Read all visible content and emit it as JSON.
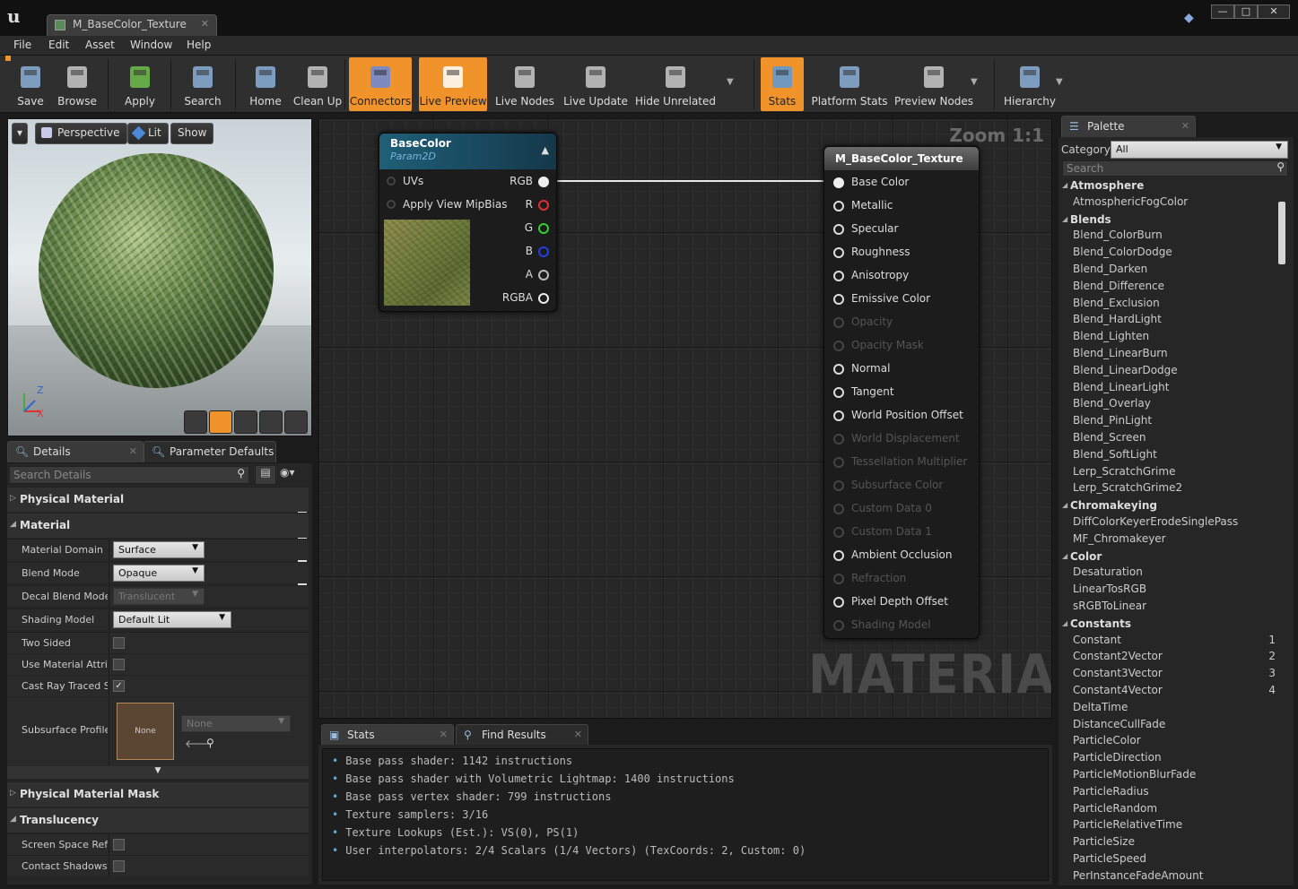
{
  "window": {
    "tab_title": "M_BaseColor_Texture",
    "controls": {
      "minimize": "—",
      "maximize": "□",
      "close": "✕"
    }
  },
  "menu": [
    "File",
    "Edit",
    "Asset",
    "Window",
    "Help"
  ],
  "toolbar": [
    {
      "label": "Save",
      "icon": "save-icon",
      "active": false
    },
    {
      "label": "Browse",
      "icon": "browse-icon",
      "active": false
    },
    {
      "label": "Apply",
      "icon": "apply-icon",
      "active": false
    },
    {
      "label": "Search",
      "icon": "search-icon",
      "active": false
    },
    {
      "label": "Home",
      "icon": "home-icon",
      "active": false
    },
    {
      "label": "Clean Up",
      "icon": "clean-up-icon",
      "active": false
    },
    {
      "label": "Connectors",
      "icon": "connectors-icon",
      "active": true
    },
    {
      "label": "Live Preview",
      "icon": "live-preview-icon",
      "active": true
    },
    {
      "label": "Live Nodes",
      "icon": "live-nodes-icon",
      "active": false
    },
    {
      "label": "Live Update",
      "icon": "live-update-icon",
      "active": false
    },
    {
      "label": "Hide Unrelated",
      "icon": "hide-unrelated-icon",
      "active": false
    },
    {
      "label": "Stats",
      "icon": "stats-icon",
      "active": true
    },
    {
      "label": "Platform Stats",
      "icon": "platform-stats-icon",
      "active": false
    },
    {
      "label": "Preview Nodes",
      "icon": "preview-nodes-icon",
      "active": false
    },
    {
      "label": "Hierarchy",
      "icon": "hierarchy-icon",
      "active": false
    }
  ],
  "viewport": {
    "buttons": {
      "menu": "▾",
      "perspective": "Perspective",
      "lit": "Lit",
      "show": "Show"
    },
    "axis": {
      "z": "Z",
      "x": "X"
    }
  },
  "details": {
    "tabs": [
      "Details",
      "Parameter Defaults"
    ],
    "search_placeholder": "Search Details",
    "sections": {
      "physical_material": "Physical Material",
      "material": "Material",
      "physical_material_mask": "Physical Material Mask",
      "translucency": "Translucency"
    },
    "props": {
      "material_domain": {
        "label": "Material Domain",
        "value": "Surface"
      },
      "blend_mode": {
        "label": "Blend Mode",
        "value": "Opaque"
      },
      "decal_blend_mode": {
        "label": "Decal Blend Mode",
        "value": "Translucent"
      },
      "shading_model": {
        "label": "Shading Model",
        "value": "Default Lit"
      },
      "two_sided": {
        "label": "Two Sided",
        "checked": false
      },
      "use_material_attributes": {
        "label": "Use Material Attributes",
        "checked": false
      },
      "cast_ray_traced_shadows": {
        "label": "Cast Ray Traced Shadows",
        "checked": true
      },
      "subsurface_profile": {
        "label": "Subsurface Profile",
        "thumb": "None",
        "value": "None"
      },
      "screen_space_reflections": {
        "label": "Screen Space Reflections",
        "checked": false
      },
      "contact_shadows": {
        "label": "Contact Shadows",
        "checked": false
      }
    }
  },
  "graph": {
    "zoom": "Zoom 1:1",
    "watermark": "MATERIAL",
    "texture_node": {
      "title": "BaseColor",
      "subtitle": "Param2D",
      "inputs": [
        "UVs",
        "Apply View MipBias"
      ],
      "outputs": [
        {
          "label": "RGB",
          "color": "#eeeeee"
        },
        {
          "label": "R",
          "color": "#e03030"
        },
        {
          "label": "G",
          "color": "#30d030"
        },
        {
          "label": "B",
          "color": "#2040e0"
        },
        {
          "label": "A",
          "color": "#bbbbbb"
        },
        {
          "label": "RGBA",
          "color": "#eeeeee"
        }
      ]
    },
    "result_node": {
      "title": "M_BaseColor_Texture",
      "inputs": [
        {
          "label": "Base Color",
          "enabled": true,
          "connected": true
        },
        {
          "label": "Metallic",
          "enabled": true
        },
        {
          "label": "Specular",
          "enabled": true
        },
        {
          "label": "Roughness",
          "enabled": true
        },
        {
          "label": "Anisotropy",
          "enabled": true
        },
        {
          "label": "Emissive Color",
          "enabled": true
        },
        {
          "label": "Opacity",
          "enabled": false
        },
        {
          "label": "Opacity Mask",
          "enabled": false
        },
        {
          "label": "Normal",
          "enabled": true
        },
        {
          "label": "Tangent",
          "enabled": true
        },
        {
          "label": "World Position Offset",
          "enabled": true
        },
        {
          "label": "World Displacement",
          "enabled": false
        },
        {
          "label": "Tessellation Multiplier",
          "enabled": false
        },
        {
          "label": "Subsurface Color",
          "enabled": false
        },
        {
          "label": "Custom Data 0",
          "enabled": false
        },
        {
          "label": "Custom Data 1",
          "enabled": false
        },
        {
          "label": "Ambient Occlusion",
          "enabled": true
        },
        {
          "label": "Refraction",
          "enabled": false
        },
        {
          "label": "Pixel Depth Offset",
          "enabled": true
        },
        {
          "label": "Shading Model",
          "enabled": false
        }
      ]
    }
  },
  "stats": {
    "tabs": [
      "Stats",
      "Find Results"
    ],
    "lines": [
      "Base pass shader: 1142 instructions",
      "Base pass shader with Volumetric Lightmap: 1400 instructions",
      "Base pass vertex shader: 799 instructions",
      "Texture samplers: 3/16",
      "Texture Lookups (Est.): VS(0), PS(1)",
      "User interpolators: 2/4 Scalars (1/4 Vectors) (TexCoords: 2, Custom: 0)"
    ]
  },
  "palette": {
    "title": "Palette",
    "category_label": "Category:",
    "category_value": "All",
    "search_placeholder": "Search",
    "items": [
      {
        "cat": "Atmosphere"
      },
      {
        "name": "AtmosphericFogColor"
      },
      {
        "cat": "Blends"
      },
      {
        "name": "Blend_ColorBurn"
      },
      {
        "name": "Blend_ColorDodge"
      },
      {
        "name": "Blend_Darken"
      },
      {
        "name": "Blend_Difference"
      },
      {
        "name": "Blend_Exclusion"
      },
      {
        "name": "Blend_HardLight"
      },
      {
        "name": "Blend_Lighten"
      },
      {
        "name": "Blend_LinearBurn"
      },
      {
        "name": "Blend_LinearDodge"
      },
      {
        "name": "Blend_LinearLight"
      },
      {
        "name": "Blend_Overlay"
      },
      {
        "name": "Blend_PinLight"
      },
      {
        "name": "Blend_Screen"
      },
      {
        "name": "Blend_SoftLight"
      },
      {
        "name": "Lerp_ScratchGrime"
      },
      {
        "name": "Lerp_ScratchGrime2"
      },
      {
        "cat": "Chromakeying"
      },
      {
        "name": "DiffColorKeyerErodeSinglePass"
      },
      {
        "name": "MF_Chromakeyer"
      },
      {
        "cat": "Color"
      },
      {
        "name": "Desaturation"
      },
      {
        "name": "LinearTosRGB"
      },
      {
        "name": "sRGBToLinear"
      },
      {
        "cat": "Constants"
      },
      {
        "name": "Constant",
        "key": "1"
      },
      {
        "name": "Constant2Vector",
        "key": "2"
      },
      {
        "name": "Constant3Vector",
        "key": "3"
      },
      {
        "name": "Constant4Vector",
        "key": "4"
      },
      {
        "name": "DeltaTime"
      },
      {
        "name": "DistanceCullFade"
      },
      {
        "name": "ParticleColor"
      },
      {
        "name": "ParticleDirection"
      },
      {
        "name": "ParticleMotionBlurFade"
      },
      {
        "name": "ParticleRadius"
      },
      {
        "name": "ParticleRandom"
      },
      {
        "name": "ParticleRelativeTime"
      },
      {
        "name": "ParticleSize"
      },
      {
        "name": "ParticleSpeed"
      },
      {
        "name": "PerInstanceFadeAmount"
      }
    ]
  }
}
